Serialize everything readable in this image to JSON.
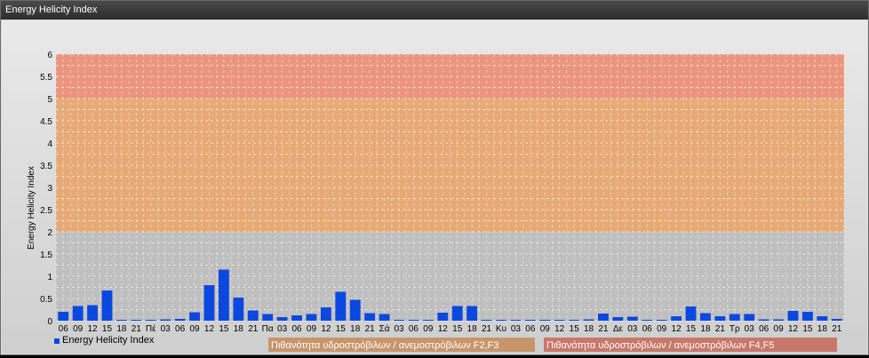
{
  "window": {
    "title": "Energy Helicity Index"
  },
  "colors": {
    "bar": "#0a48e0",
    "band_low": "#bdbdbd",
    "band_mid": "#e8a46c",
    "band_high": "#eb8c72",
    "grid": "#ffffff",
    "legend_f23": "#c8956b",
    "legend_f45": "#c8786a"
  },
  "chart_data": {
    "type": "bar",
    "ylabel": "Energy Helicity Index",
    "ylim": [
      0,
      6
    ],
    "yticks": [
      "0",
      "0.5",
      "1",
      "1.5",
      "2",
      "2.5",
      "3",
      "3.5",
      "4",
      "4.5",
      "5",
      "5.5",
      "6"
    ],
    "bands": [
      {
        "from": 0,
        "to": 2,
        "color": "#bdbdbd"
      },
      {
        "from": 2,
        "to": 5,
        "color": "#e8a46c",
        "label": "Πιθανότητα υδροστρόβιλων / ανεμοστρόβιλων F2,F3"
      },
      {
        "from": 5,
        "to": 6,
        "color": "#eb8c72",
        "label": "Πιθανότητα υδροστρόβιλων / ανεμοστρόβιλων F4,F5"
      }
    ],
    "categories": [
      "06",
      "09",
      "12",
      "15",
      "18",
      "21",
      "Πέ",
      "03",
      "06",
      "09",
      "12",
      "15",
      "18",
      "21",
      "Πα",
      "03",
      "06",
      "09",
      "12",
      "15",
      "18",
      "21",
      "Σά",
      "03",
      "06",
      "09",
      "12",
      "15",
      "18",
      "21",
      "Κυ",
      "03",
      "06",
      "09",
      "12",
      "15",
      "18",
      "21",
      "Δε",
      "03",
      "06",
      "09",
      "12",
      "15",
      "18",
      "21",
      "Τρ",
      "03",
      "06",
      "09",
      "12",
      "15",
      "18",
      "21"
    ],
    "series": [
      {
        "name": "Energy Helicity Index",
        "values": [
          0.2,
          0.33,
          0.35,
          0.68,
          0.02,
          0.02,
          0.02,
          0.03,
          0.04,
          0.19,
          0.8,
          1.15,
          0.52,
          0.23,
          0.15,
          0.08,
          0.12,
          0.15,
          0.3,
          0.65,
          0.47,
          0.17,
          0.15,
          0.02,
          0.02,
          0.02,
          0.18,
          0.33,
          0.33,
          0.02,
          0.02,
          0.02,
          0.02,
          0.02,
          0.02,
          0.02,
          0.03,
          0.16,
          0.08,
          0.09,
          0.02,
          0.02,
          0.1,
          0.32,
          0.17,
          0.1,
          0.15,
          0.15,
          0.03,
          0.03,
          0.22,
          0.2,
          0.1,
          0.04
        ]
      }
    ]
  }
}
